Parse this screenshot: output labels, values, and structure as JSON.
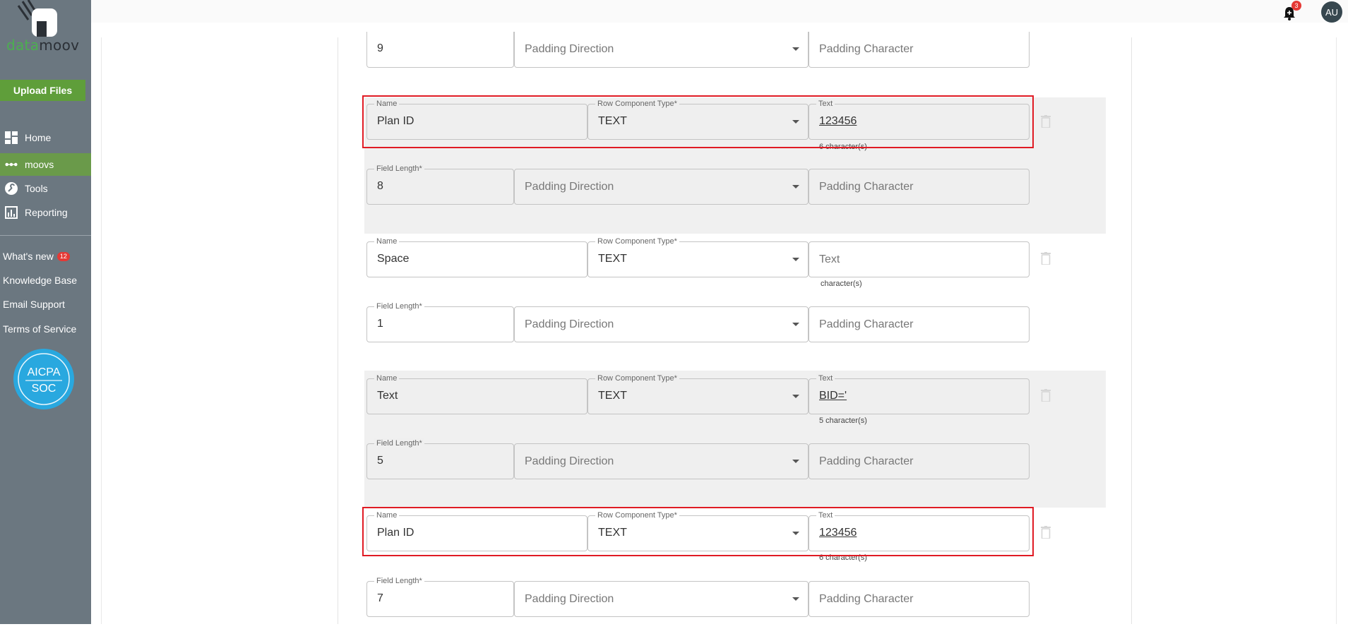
{
  "sidebar": {
    "brand": {
      "part1": "data",
      "part2": "moov"
    },
    "upload_label": "Upload Files",
    "nav": [
      {
        "label": "Home",
        "icon": "dashboard-icon"
      },
      {
        "label": "moovs",
        "icon": "dots-icon",
        "active": true
      },
      {
        "label": "Tools",
        "icon": "wrench-icon"
      },
      {
        "label": "Reporting",
        "icon": "chart-icon"
      }
    ],
    "links": [
      {
        "label": "What's new",
        "badge": "12"
      },
      {
        "label": "Knowledge Base"
      },
      {
        "label": "Email Support"
      },
      {
        "label": "Terms of Service"
      }
    ],
    "aicpa": {
      "top": "AICPA",
      "bottom": "SOC"
    }
  },
  "header": {
    "notification_count": "3",
    "avatar_initials": "AU"
  },
  "rows": {
    "r0": {
      "field_length_value": "9",
      "padding_direction_placeholder": "Padding Direction",
      "padding_character_placeholder": "Padding Character"
    },
    "r1": {
      "name_label": "Name",
      "name_value": "Plan ID",
      "type_label": "Row Component Type*",
      "type_value": "TEXT",
      "text_label": "Text",
      "text_value": "123456",
      "helper": "6 character(s)",
      "field_length_label": "Field Length*",
      "field_length_value": "8",
      "padding_direction_placeholder": "Padding Direction",
      "padding_character_placeholder": "Padding Character"
    },
    "r2": {
      "name_label": "Name",
      "name_value": "Space",
      "type_label": "Row Component Type*",
      "type_value": "TEXT",
      "text_placeholder": "Text",
      "helper": "character(s)",
      "field_length_label": "Field Length*",
      "field_length_value": "1",
      "padding_direction_placeholder": "Padding Direction",
      "padding_character_placeholder": "Padding Character"
    },
    "r3": {
      "name_label": "Name",
      "name_value": "Text",
      "type_label": "Row Component Type*",
      "type_value": "TEXT",
      "text_label": "Text",
      "text_value": "BID='",
      "helper": "5 character(s)",
      "field_length_label": "Field Length*",
      "field_length_value": "5",
      "padding_direction_placeholder": "Padding Direction",
      "padding_character_placeholder": "Padding Character"
    },
    "r4": {
      "name_label": "Name",
      "name_value": "Plan ID",
      "type_label": "Row Component Type*",
      "type_value": "TEXT",
      "text_label": "Text",
      "text_value": "123456",
      "helper": "6 character(s)",
      "field_length_label": "Field Length*",
      "field_length_value": "7",
      "padding_direction_placeholder": "Padding Direction",
      "padding_character_placeholder": "Padding Character"
    }
  },
  "colors": {
    "sidebar": "#6b7780",
    "accent": "#5f9e3a",
    "highlight": "#e01b24"
  }
}
